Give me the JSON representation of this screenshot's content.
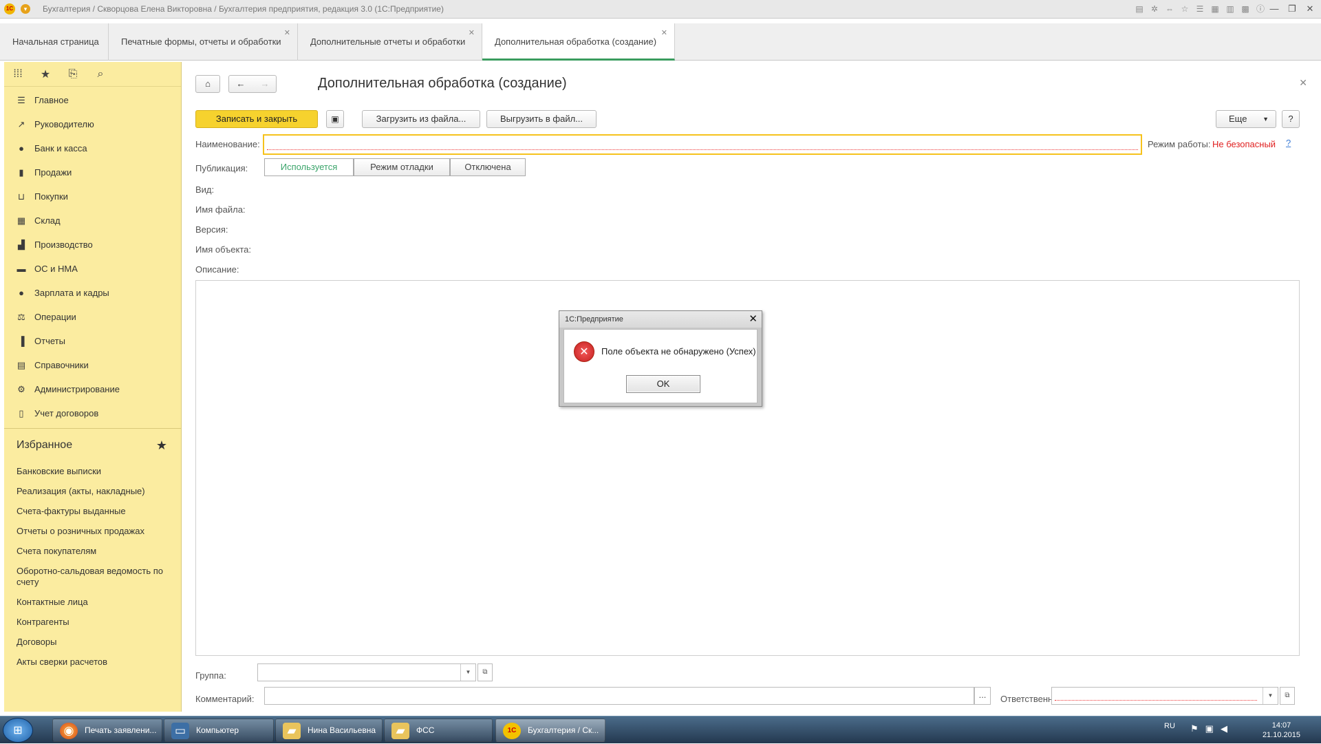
{
  "window": {
    "title": "Бухгалтерия / Скворцова Елена Викторовна / Бухгалтерия предприятия, редакция 3.0  (1С:Предприятие)",
    "logo_text": "1С"
  },
  "tabs": [
    {
      "label": "Начальная страница"
    },
    {
      "label": "Печатные формы, отчеты и обработки"
    },
    {
      "label": "Дополнительные отчеты и обработки"
    },
    {
      "label": "Дополнительная обработка (создание)"
    }
  ],
  "sidebar": {
    "sections": [
      {
        "label": "Главное",
        "icon": "menu-icon"
      },
      {
        "label": "Руководителю",
        "icon": "trend-icon"
      },
      {
        "label": "Банк и касса",
        "icon": "coin-icon"
      },
      {
        "label": "Продажи",
        "icon": "bag-icon"
      },
      {
        "label": "Покупки",
        "icon": "cart-icon"
      },
      {
        "label": "Склад",
        "icon": "grid-icon"
      },
      {
        "label": "Производство",
        "icon": "factory-icon"
      },
      {
        "label": "ОС и НМА",
        "icon": "truck-icon"
      },
      {
        "label": "Зарплата и кадры",
        "icon": "person-icon"
      },
      {
        "label": "Операции",
        "icon": "scales-icon"
      },
      {
        "label": "Отчеты",
        "icon": "bar-chart-icon"
      },
      {
        "label": "Справочники",
        "icon": "book-icon"
      },
      {
        "label": "Администрирование",
        "icon": "gear-icon"
      },
      {
        "label": "Учет договоров",
        "icon": "document-icon"
      }
    ],
    "favorites_title": "Избранное",
    "favorites": [
      "Банковские выписки",
      "Реализация (акты, накладные)",
      "Счета-фактуры выданные",
      "Отчеты о розничных продажах",
      "Счета покупателям",
      "Оборотно-сальдовая ведомость по счету",
      "Контактные лица",
      "Контрагенты",
      "Договоры",
      "Акты сверки расчетов"
    ]
  },
  "form": {
    "title": "Дополнительная обработка (создание)",
    "buttons": {
      "save_close": "Записать и закрыть",
      "load_file": "Загрузить из файла...",
      "unload_file": "Выгрузить в файл...",
      "more": "Еще",
      "help": "?"
    },
    "fields": {
      "name_label": "Наименование:",
      "name_value": "",
      "mode_label": "Режим работы:",
      "mode_value": "Не безопасный",
      "mode_help": "?",
      "publication_label": "Публикация:",
      "publication_options": [
        "Используется",
        "Режим отладки",
        "Отключена"
      ],
      "publication_selected": "Используется",
      "kind_label": "Вид:",
      "filename_label": "Имя файла:",
      "version_label": "Версия:",
      "object_name_label": "Имя объекта:",
      "description_label": "Описание:",
      "group_label": "Группа:",
      "comment_label": "Комментарий:",
      "comment_button": "...",
      "responsible_label": "Ответственный:"
    },
    "accent_color": "#f6d22e",
    "error_color": "#e02020"
  },
  "dialog": {
    "title": "1С:Предприятие",
    "message": "Поле объекта не обнаружено (Успех)",
    "ok_label": "OK"
  },
  "taskbar": {
    "items": [
      {
        "label": "Печать заявлени...",
        "icon": "firefox-icon"
      },
      {
        "label": "Компьютер",
        "icon": "computer-icon"
      },
      {
        "label": "Нина Васильевна",
        "icon": "folder-icon"
      },
      {
        "label": "ФСС",
        "icon": "folder-icon"
      },
      {
        "label": "Бухгалтерия / Ск...",
        "icon": "1c-icon"
      }
    ],
    "lang": "RU",
    "time": "14:07",
    "date": "21.10.2015"
  }
}
